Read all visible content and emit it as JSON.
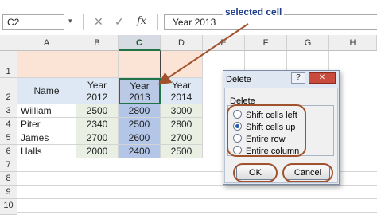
{
  "formula_bar": {
    "name_box": "C2",
    "dropdown_glyph": "▾",
    "cancel_glyph": "✕",
    "enter_glyph": "✓",
    "fx_glyph": "fx",
    "formula_value": "Year  2013"
  },
  "annotation": {
    "callout": "selected cell",
    "color": "#a0522d"
  },
  "columns": [
    "A",
    "B",
    "C",
    "D",
    "E",
    "F",
    "G",
    "H"
  ],
  "selected_column": "C",
  "rows": [
    "1",
    "2",
    "3",
    "4",
    "5",
    "6",
    "7",
    "8",
    "9",
    "10"
  ],
  "table": {
    "name_header": "Name",
    "year_headers": [
      {
        "line1": "Year",
        "line2": "2012"
      },
      {
        "line1": "Year",
        "line2": "2013"
      },
      {
        "line1": "Year",
        "line2": "2014"
      }
    ],
    "records": [
      {
        "name": "William",
        "values": [
          "2500",
          "2800",
          "3000"
        ]
      },
      {
        "name": "Piter",
        "values": [
          "2340",
          "2500",
          "2800"
        ]
      },
      {
        "name": "James",
        "values": [
          "2700",
          "2600",
          "2700"
        ]
      },
      {
        "name": "Halls",
        "values": [
          "2000",
          "2400",
          "2500"
        ]
      }
    ]
  },
  "colors": {
    "peach": "#fbe3d6",
    "header_blue": "#dde8f4",
    "body_green": "#e9efe3",
    "selected_blue": "#b4c6e7",
    "selected_cell": "#b9c9e6"
  },
  "dialog": {
    "title": "Delete",
    "help_glyph": "?",
    "close_glyph": "✕",
    "group_label": "Delete",
    "options": [
      {
        "label": "Shift cells left",
        "selected": false
      },
      {
        "label": "Shift cells up",
        "selected": true
      },
      {
        "label": "Entire row",
        "selected": false
      },
      {
        "label": "Entire column",
        "selected": false
      }
    ],
    "ok_label": "OK",
    "cancel_label": "Cancel"
  }
}
